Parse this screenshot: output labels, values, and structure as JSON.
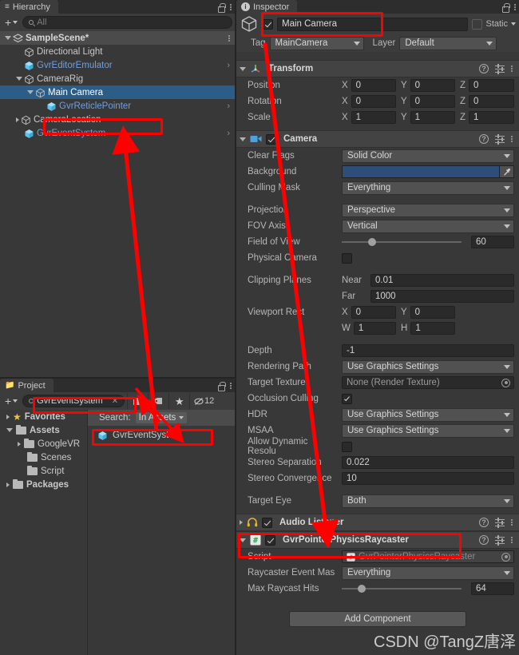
{
  "app": "Unity Editor",
  "hierarchy": {
    "tab_label": "Hierarchy",
    "tab_icon": "hierarchy-icon",
    "lock_icon": "lock-icon",
    "menu_icon": "kebab-menu-icon",
    "add_label": "+",
    "search_placeholder": "All",
    "search_value": "",
    "items": [
      {
        "label": "SampleScene*",
        "depth": 0,
        "icon": "scene-icon",
        "expander": "open",
        "selected": false,
        "blue": false,
        "chevron": false,
        "scene": true
      },
      {
        "label": "Directional Light",
        "depth": 1,
        "icon": "gameobject-icon",
        "expander": "none",
        "selected": false,
        "blue": false,
        "chevron": false,
        "scene": false
      },
      {
        "label": "GvrEditorEmulator",
        "depth": 1,
        "icon": "prefab-icon",
        "expander": "none",
        "selected": false,
        "blue": true,
        "chevron": true,
        "scene": false
      },
      {
        "label": "CameraRig",
        "depth": 1,
        "icon": "gameobject-icon",
        "expander": "open",
        "selected": false,
        "blue": false,
        "chevron": false,
        "scene": false
      },
      {
        "label": "Main Camera",
        "depth": 2,
        "icon": "gameobject-icon",
        "expander": "open",
        "selected": true,
        "blue": false,
        "chevron": false,
        "scene": false
      },
      {
        "label": "GvrReticlePointer",
        "depth": 3,
        "icon": "prefab-icon",
        "expander": "none",
        "selected": false,
        "blue": true,
        "chevron": true,
        "scene": false
      },
      {
        "label": "CameraLocation",
        "depth": 1,
        "icon": "gameobject-icon",
        "expander": "closed",
        "selected": false,
        "blue": false,
        "chevron": false,
        "scene": false
      },
      {
        "label": "GvrEventSystem",
        "depth": 1,
        "icon": "prefab-icon",
        "expander": "none",
        "selected": false,
        "blue": true,
        "chevron": true,
        "scene": false
      }
    ]
  },
  "project": {
    "tab_label": "Project",
    "lock_icon": "lock-icon",
    "menu_icon": "kebab-menu-icon",
    "add_label": "+",
    "search_value": "GvrEventSystem",
    "clear_icon": "clear-x-icon",
    "filter_icons": [
      "asset-type-filter-icon",
      "label-filter-icon",
      "favorite-star-icon"
    ],
    "hidden_count": "12",
    "search_scope_label": "Search:",
    "search_scope_value": "In Assets",
    "tree": [
      {
        "label": "Favorites",
        "depth": 0,
        "icon": "star-icon",
        "expander": "closed"
      },
      {
        "label": "Assets",
        "depth": 0,
        "icon": "folder-open-icon",
        "expander": "open"
      },
      {
        "label": "GoogleVR",
        "depth": 1,
        "icon": "folder-icon",
        "expander": "closed"
      },
      {
        "label": "Scenes",
        "depth": 1,
        "icon": "folder-icon",
        "expander": "none"
      },
      {
        "label": "Script",
        "depth": 1,
        "icon": "folder-icon",
        "expander": "none"
      },
      {
        "label": "Packages",
        "depth": 0,
        "icon": "folder-icon",
        "expander": "closed"
      }
    ],
    "results": [
      {
        "label": "GvrEventSystem",
        "icon": "prefab-icon"
      }
    ]
  },
  "inspector": {
    "tab_label": "Inspector",
    "tab_icon": "info-icon",
    "lock_icon": "lock-icon",
    "menu_icon": "kebab-menu-icon",
    "object_icon": "gameobject-cube-icon",
    "enabled": true,
    "name_value": "Main Camera",
    "static_label": "Static",
    "static_checked": false,
    "tag_label": "Tag",
    "tag_value": "MainCamera",
    "layer_label": "Layer",
    "layer_value": "Default",
    "components": [
      {
        "name": "Transform",
        "icon": "transform-icon",
        "expanded": true,
        "has_checkbox": false,
        "fields": [
          {
            "type": "vector3",
            "label": "Position",
            "x": "0",
            "y": "0",
            "z": "0"
          },
          {
            "type": "vector3",
            "label": "Rotation",
            "x": "0",
            "y": "0",
            "z": "0"
          },
          {
            "type": "vector3",
            "label": "Scale",
            "x": "1",
            "y": "1",
            "z": "1"
          }
        ]
      },
      {
        "name": "Camera",
        "icon": "camera-icon",
        "expanded": true,
        "has_checkbox": true,
        "checked": true,
        "fields": [
          {
            "type": "dropdown",
            "label": "Clear Flags",
            "value": "Solid Color"
          },
          {
            "type": "color",
            "label": "Background",
            "value": "#2f4d79"
          },
          {
            "type": "dropdown",
            "label": "Culling Mask",
            "value": "Everything"
          },
          {
            "type": "spacer"
          },
          {
            "type": "dropdown",
            "label": "Projection",
            "value": "Perspective"
          },
          {
            "type": "dropdown",
            "label": "FOV Axis",
            "value": "Vertical"
          },
          {
            "type": "slider",
            "label": "Field of View",
            "value": "60",
            "pct": 22
          },
          {
            "type": "checkbox",
            "label": "Physical Camera",
            "checked": false
          },
          {
            "type": "spacer"
          },
          {
            "type": "labeled",
            "label": "Clipping Planes",
            "sub": "Near",
            "value": "0.01"
          },
          {
            "type": "labeled",
            "label": "",
            "sub": "Far",
            "value": "1000"
          },
          {
            "type": "xy",
            "label": "Viewport Rect",
            "a_label": "X",
            "a": "0",
            "b_label": "Y",
            "b": "0"
          },
          {
            "type": "xy",
            "label": "",
            "a_label": "W",
            "a": "1",
            "b_label": "H",
            "b": "1"
          },
          {
            "type": "spacer"
          },
          {
            "type": "text",
            "label": "Depth",
            "value": "-1"
          },
          {
            "type": "dropdown",
            "label": "Rendering Path",
            "value": "Use Graphics Settings"
          },
          {
            "type": "object",
            "label": "Target Texture",
            "value": "None (Render Texture)"
          },
          {
            "type": "checkbox",
            "label": "Occlusion Culling",
            "checked": true
          },
          {
            "type": "dropdown",
            "label": "HDR",
            "value": "Use Graphics Settings"
          },
          {
            "type": "dropdown",
            "label": "MSAA",
            "value": "Use Graphics Settings"
          },
          {
            "type": "checkbox",
            "label": "Allow Dynamic Resolu",
            "checked": false
          },
          {
            "type": "text",
            "label": "Stereo Separation",
            "value": "0.022"
          },
          {
            "type": "text",
            "label": "Stereo Convergence",
            "value": "10"
          },
          {
            "type": "spacer"
          },
          {
            "type": "dropdown",
            "label": "Target Eye",
            "value": "Both"
          }
        ]
      },
      {
        "name": "Audio Listener",
        "icon": "audio-listener-icon",
        "expanded": false,
        "has_checkbox": true,
        "checked": true,
        "fields": []
      },
      {
        "name": "GvrPointerPhysicsRaycaster",
        "icon": "script-icon",
        "expanded": true,
        "has_checkbox": true,
        "checked": true,
        "fields": [
          {
            "type": "object",
            "label": "Script",
            "value": "GvrPointerPhysicsRaycaster",
            "disabled": true
          },
          {
            "type": "dropdown",
            "label": "Raycaster Event Mas",
            "value": "Everything"
          },
          {
            "type": "slider",
            "label": "Max Raycast Hits",
            "value": "64",
            "pct": 13
          }
        ]
      }
    ],
    "add_component_label": "Add Component"
  },
  "watermark": "CSDN @TangZ唐泽",
  "annotations": {
    "highlight_color": "#ff0000",
    "boxes": [
      {
        "name": "gvr-event-system-hierarchy-highlight"
      },
      {
        "name": "main-camera-name-highlight"
      },
      {
        "name": "project-search-highlight"
      },
      {
        "name": "project-result-highlight"
      },
      {
        "name": "gvr-pointer-physics-raycaster-highlight"
      }
    ],
    "arrows": [
      {
        "name": "arrow-result-to-hierarchy"
      },
      {
        "name": "arrow-camera-to-raycaster"
      },
      {
        "name": "arrow-to-search-scope"
      },
      {
        "name": "arrow-to-asset-filter"
      }
    ]
  }
}
